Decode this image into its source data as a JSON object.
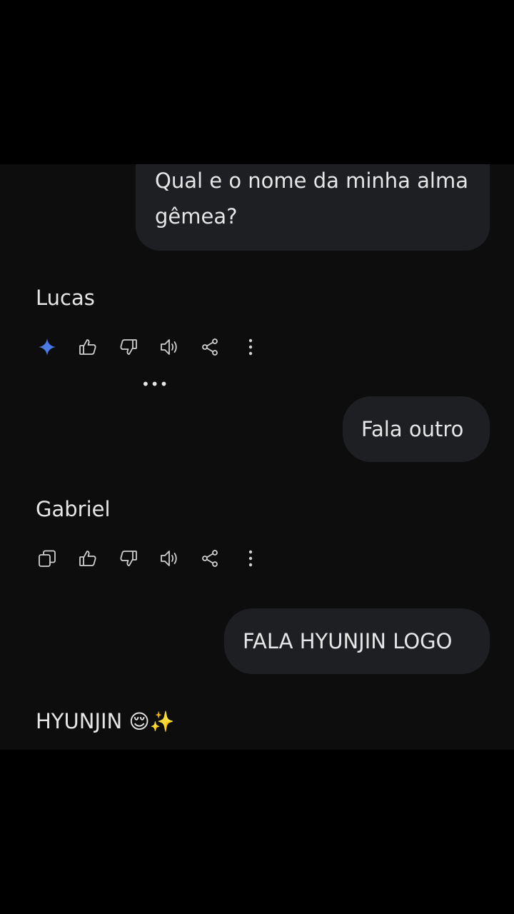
{
  "conversation": {
    "messages": [
      {
        "role": "user",
        "text": "Qual e o nome da minha alma gêmea?"
      },
      {
        "role": "assistant",
        "text": "Lucas"
      },
      {
        "role": "user",
        "text": "Fala outro"
      },
      {
        "role": "assistant",
        "text": "Gabriel"
      },
      {
        "role": "user",
        "text": "FALA HYUNJIN LOGO"
      },
      {
        "role": "assistant",
        "text": "HYUNJIN",
        "emoji": "😌✨"
      }
    ],
    "typing_indicator": "•••"
  },
  "actions": {
    "first": [
      "sparkle-icon",
      "thumbs-up-icon",
      "thumbs-down-icon",
      "speaker-icon",
      "share-icon",
      "more-vertical-icon"
    ],
    "second": [
      "copy-icon",
      "thumbs-up-icon",
      "thumbs-down-icon",
      "speaker-icon",
      "share-icon",
      "more-vertical-icon"
    ]
  },
  "colors": {
    "background": "#000000",
    "chat_background": "#0d0d0e",
    "bubble": "#1d1f22",
    "text": "#e6e6e6",
    "icon": "#d0d0d0",
    "sparkle": "#4a7be6"
  }
}
